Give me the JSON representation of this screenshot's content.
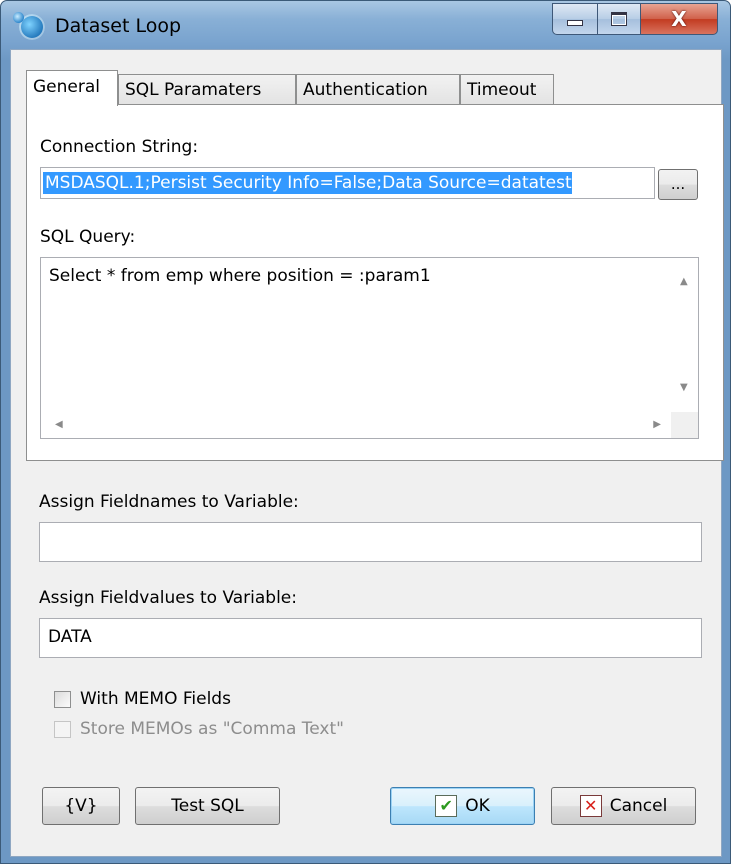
{
  "window": {
    "title": "Dataset Loop",
    "controls": {
      "minimize": "_",
      "maximize": "□",
      "close": "X"
    }
  },
  "tabs": [
    {
      "label": "General",
      "active": true
    },
    {
      "label": "SQL Paramaters",
      "active": false
    },
    {
      "label": "Authentication",
      "active": false
    },
    {
      "label": "Timeout",
      "active": false
    }
  ],
  "general": {
    "connection_label": "Connection String:",
    "connection_value": "MSDASQL.1;Persist Security Info=False;Data Source=datatest",
    "browse_button": "...",
    "query_label": "SQL Query:",
    "query_value": "Select * from emp where position = :param1"
  },
  "fieldnames": {
    "label": "Assign Fieldnames to Variable:",
    "value": ""
  },
  "fieldvalues": {
    "label": "Assign Fieldvalues to Variable:",
    "value": "DATA"
  },
  "options": {
    "memo_fields": {
      "label": "With MEMO Fields",
      "checked": false,
      "enabled": true
    },
    "comma_text": {
      "label": "Store MEMOs as \"Comma Text\"",
      "checked": false,
      "enabled": false
    }
  },
  "buttons": {
    "variables": "{V}",
    "test_sql": "Test SQL",
    "ok": "OK",
    "cancel": "Cancel"
  },
  "icons": {
    "app": "dataset-loop-icon",
    "ok": "checkmark-icon",
    "cancel": "x-icon",
    "ok_color": "#2c9a1f",
    "cancel_color": "#d8201a",
    "selection_color": "#3399ff"
  }
}
